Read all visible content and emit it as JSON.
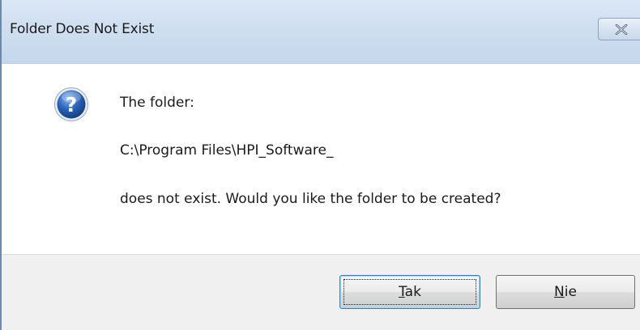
{
  "window": {
    "title": "Folder Does Not Exist"
  },
  "message": {
    "line1": "The folder:",
    "line2": "C:\\Program Files\\HPI_Software_",
    "line3": "does not exist. Would you like the folder to be created?"
  },
  "icons": {
    "message_icon": "question-icon",
    "close_icon": "close-icon"
  },
  "buttons": {
    "yes": {
      "mnemonic": "T",
      "rest": "ak"
    },
    "no": {
      "mnemonic": "N",
      "rest": "ie"
    }
  },
  "colors": {
    "titlebar": "#cfdff0",
    "button_bar": "#f0f0f0",
    "question_icon": "#2a63b8"
  }
}
